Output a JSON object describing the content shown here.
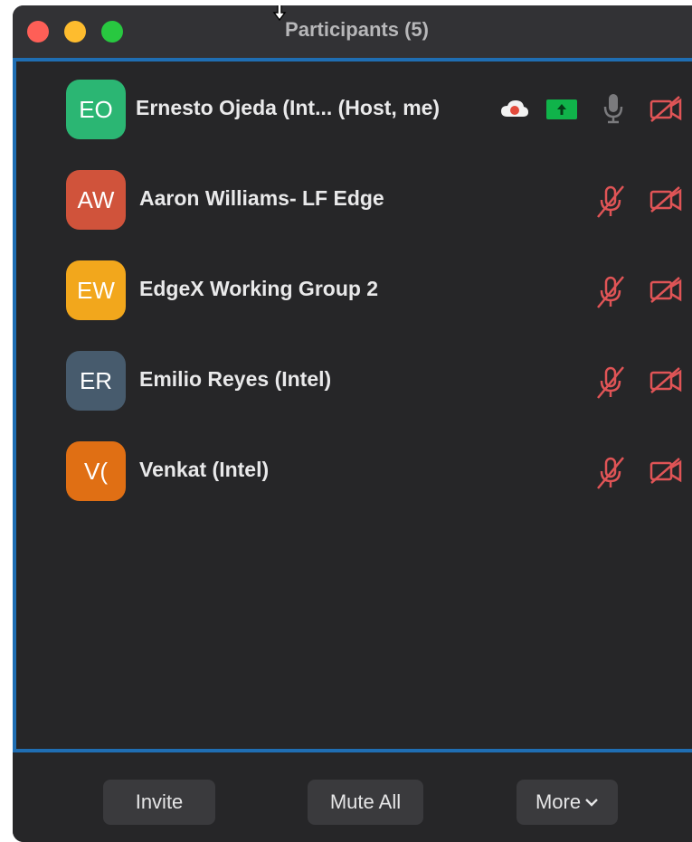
{
  "window": {
    "title": "Participants (5)"
  },
  "participants": [
    {
      "initials": "EO",
      "name": "Ernesto Ojeda (Int...  (Host, me)",
      "avatar_color": "#2bb673"
    },
    {
      "initials": "AW",
      "name": "Aaron Williams- LF Edge",
      "avatar_color": "#d0533b"
    },
    {
      "initials": "EW",
      "name": "EdgeX Working Group 2",
      "avatar_color": "#f2a71c"
    },
    {
      "initials": "ER",
      "name": "Emilio Reyes (Intel)",
      "avatar_color": "#475b6d"
    },
    {
      "initials": "V(",
      "name": "Venkat (Intel)",
      "avatar_color": "#e06f14"
    }
  ],
  "host_indicators": [
    "cloud-recording-icon",
    "screen-share-icon",
    "microphone-icon",
    "video-off-icon"
  ],
  "muted_icons": [
    "microphone-muted-icon",
    "video-off-icon"
  ],
  "footer": {
    "invite_label": "Invite",
    "mute_all_label": "Mute All",
    "more_label": "More"
  },
  "colors": {
    "accent_border": "#1f6eb3",
    "muted_red": "#e05456",
    "share_green": "#10b34a"
  }
}
